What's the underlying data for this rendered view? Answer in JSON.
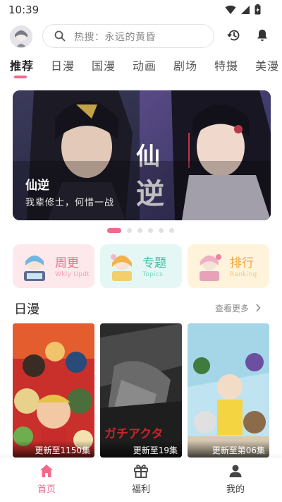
{
  "status_bar": {
    "time": "10:39"
  },
  "search": {
    "placeholder": "热搜：永远的黄昏"
  },
  "tabs": [
    {
      "label": "推荐",
      "active": true
    },
    {
      "label": "日漫",
      "active": false
    },
    {
      "label": "国漫",
      "active": false
    },
    {
      "label": "动画",
      "active": false
    },
    {
      "label": "剧场",
      "active": false
    },
    {
      "label": "特摄",
      "active": false
    },
    {
      "label": "美漫",
      "active": false
    }
  ],
  "banner": {
    "title": "仙逆",
    "subtitle": "我辈修士，何惜一战",
    "art_text": "仙逆",
    "slide_count": 6,
    "active_slide": 1
  },
  "quick_entries": [
    {
      "title": "周更",
      "subtitle": "Wkly Updt",
      "bg": "#fde8ec",
      "title_color": "#f26d87",
      "sub_color": "#f4a3b3"
    },
    {
      "title": "专题",
      "subtitle": "Topics",
      "bg": "#e5f7f4",
      "title_color": "#3cbfa6",
      "sub_color": "#7fd4c3"
    },
    {
      "title": "排行",
      "subtitle": "Ranking",
      "bg": "#fff3dc",
      "title_color": "#f2a93b",
      "sub_color": "#f4c77a"
    }
  ],
  "section": {
    "title": "日漫",
    "more_label": "查看更多"
  },
  "covers": [
    {
      "label": "更新至1150集"
    },
    {
      "label": "更新至19集",
      "art_text": "ガチアクタ"
    },
    {
      "label": "更新至第06集"
    }
  ],
  "bottom_nav": [
    {
      "label": "首页",
      "active": true
    },
    {
      "label": "福利",
      "active": false
    },
    {
      "label": "我的",
      "active": false
    }
  ],
  "colors": {
    "accent": "#f06a8c"
  }
}
